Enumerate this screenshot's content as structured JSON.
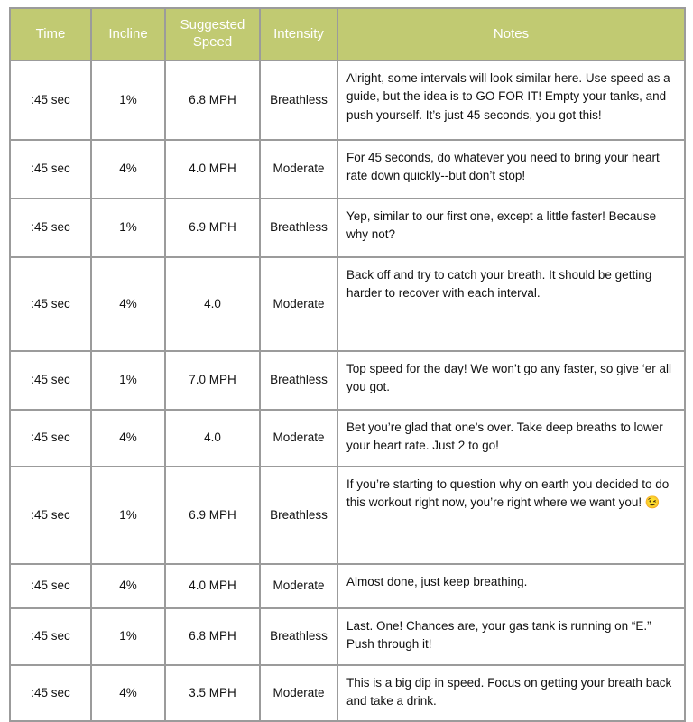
{
  "table": {
    "accent_header_bg": "#c1ca72",
    "header_text_color": "#ffffff",
    "border_color": "#9b9b9b",
    "columns": [
      {
        "key": "time",
        "label": "Time"
      },
      {
        "key": "incline",
        "label": "Incline"
      },
      {
        "key": "speed",
        "label": "Suggested Speed"
      },
      {
        "key": "intensity",
        "label": "Intensity"
      },
      {
        "key": "notes",
        "label": "Notes"
      }
    ],
    "rows": [
      {
        "time": ":45 sec",
        "incline": "1%",
        "speed": "6.8 MPH",
        "intensity": "Breathless",
        "notes": "Alright, some intervals will look similar here. Use speed as a guide, but the idea is to GO FOR IT! Empty your tanks, and push yourself. It’s just 45 seconds, you got this!"
      },
      {
        "time": ":45 sec",
        "incline": "4%",
        "speed": "4.0 MPH",
        "intensity": "Moderate",
        "notes": "For 45 seconds, do whatever you need to bring your heart rate down quickly--but don’t stop!"
      },
      {
        "time": ":45 sec",
        "incline": "1%",
        "speed": "6.9 MPH",
        "intensity": "Breathless",
        "notes": "Yep, similar to our first one, except a little faster! Because why not?"
      },
      {
        "time": ":45 sec",
        "incline": "4%",
        "speed": "4.0",
        "intensity": "Moderate",
        "notes": "Back off and try to catch your breath. It should be getting harder to recover with each interval."
      },
      {
        "time": ":45 sec",
        "incline": "1%",
        "speed": "7.0 MPH",
        "intensity": "Breathless",
        "notes": "Top speed for the day! We won’t go any faster, so give ‘er all you got."
      },
      {
        "time": ":45 sec",
        "incline": "4%",
        "speed": "4.0",
        "intensity": "Moderate",
        "notes": "Bet you’re glad that one’s over. Take deep breaths to lower your heart rate. Just 2 to go!"
      },
      {
        "time": ":45 sec",
        "incline": "1%",
        "speed": "6.9 MPH",
        "intensity": "Breathless",
        "notes": "If you’re starting to question why on earth you decided to do this workout right now, you’re right where we want you! 😉"
      },
      {
        "time": ":45 sec",
        "incline": "4%",
        "speed": "4.0 MPH",
        "intensity": "Moderate",
        "notes": "Almost done, just keep breathing."
      },
      {
        "time": ":45 sec",
        "incline": "1%",
        "speed": "6.8 MPH",
        "intensity": "Breathless",
        "notes": "Last. One! Chances are, your gas tank is running on “E.” Push through it!"
      },
      {
        "time": ":45 sec",
        "incline": "4%",
        "speed": "3.5 MPH",
        "intensity": "Moderate",
        "notes": "This is a big dip in speed. Focus on getting your breath back and take a drink."
      }
    ]
  }
}
